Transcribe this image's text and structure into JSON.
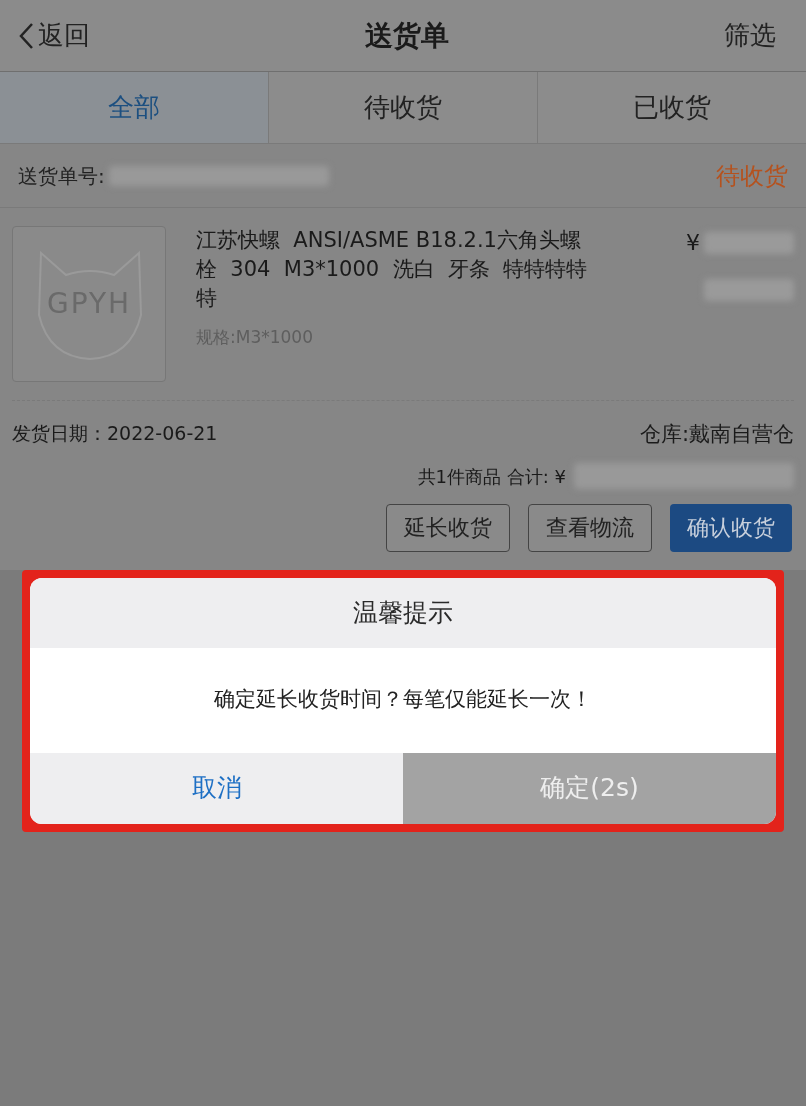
{
  "nav": {
    "back_label": "返回",
    "title": "送货单",
    "filter_label": "筛选"
  },
  "tabs": [
    {
      "label": "全部",
      "selected": true
    },
    {
      "label": "待收货",
      "selected": false
    },
    {
      "label": "已收货",
      "selected": false
    }
  ],
  "order": {
    "number_label": "送货单号:",
    "status": "待收货",
    "product": {
      "image_text": "GPYH",
      "name": "江苏快螺  ANSI/ASME B18.2.1六角头螺栓  304  M3*1000  洗白  牙条  特特特特特",
      "spec": "规格:M3*1000",
      "price_symbol": "¥"
    },
    "ship_date": "发货日期：2022-06-21",
    "warehouse": "仓库:戴南自营仓",
    "summary": "共1件商品 合计: ¥",
    "actions": [
      {
        "label": "延长收货",
        "kind": "outline"
      },
      {
        "label": "查看物流",
        "kind": "outline"
      },
      {
        "label": "确认收货",
        "kind": "primary"
      }
    ]
  },
  "dialog": {
    "title": "温馨提示",
    "message": "确定延长收货时间？每笔仅能延长一次！",
    "highlighted": true,
    "buttons": [
      {
        "label": "取消",
        "disabled": false
      },
      {
        "label": "确定(2s)",
        "disabled": true
      }
    ]
  }
}
